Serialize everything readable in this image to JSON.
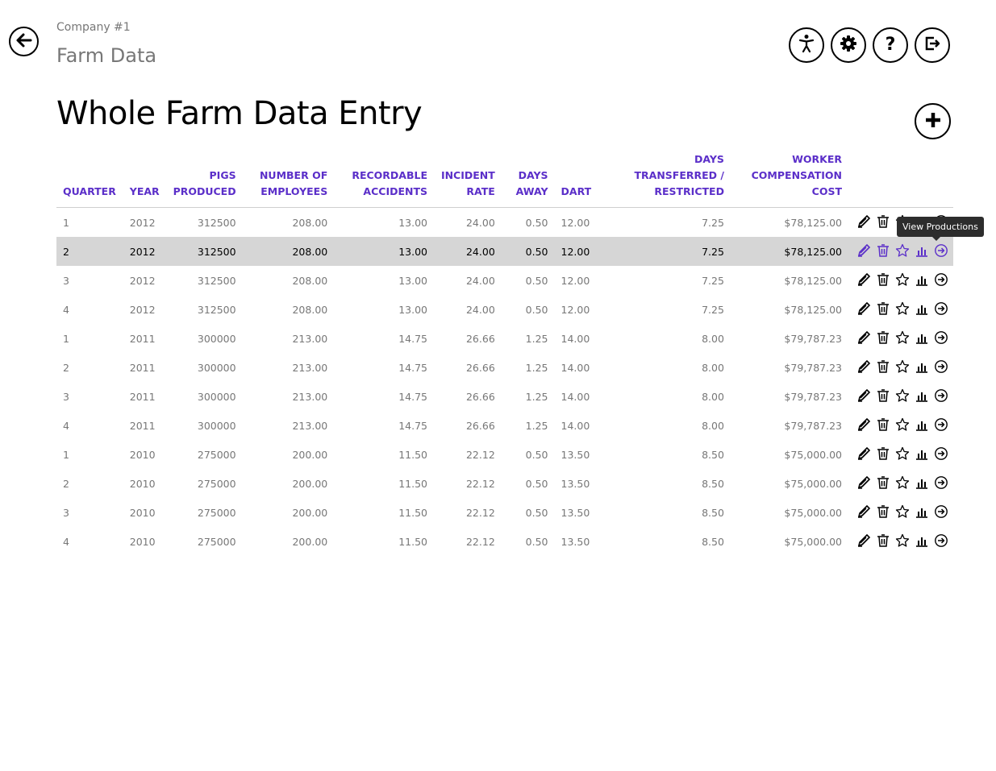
{
  "header": {
    "subtitle": "Company #1",
    "section_title": "Farm Data",
    "page_heading": "Whole Farm Data Entry",
    "back_icon": "arrow-left-icon",
    "top_buttons": [
      "accessibility-icon",
      "gear-icon",
      "help-icon",
      "logout-icon"
    ],
    "add_icon": "plus-icon"
  },
  "table": {
    "columns": [
      {
        "line1": "",
        "line2": "QUARTER"
      },
      {
        "line1": "",
        "line2": "YEAR"
      },
      {
        "line1": "PIGS",
        "line2": "PRODUCED"
      },
      {
        "line1": "NUMBER OF",
        "line2": "EMPLOYEES"
      },
      {
        "line1": "RECORDABLE",
        "line2": "ACCIDENTS"
      },
      {
        "line1": "INCIDENT",
        "line2": "RATE"
      },
      {
        "line1": "DAYS",
        "line2": "AWAY"
      },
      {
        "line1": "",
        "line2": "DART"
      },
      {
        "line1": "DAYS TRANSFERRED /",
        "line2": "RESTRICTED"
      },
      {
        "line0": "WORKER",
        "line1": "COMPENSATION",
        "line2": "COST"
      }
    ],
    "rows": [
      [
        "1",
        "2012",
        "312500",
        "208.00",
        "13.00",
        "24.00",
        "0.50",
        "12.00",
        "7.25",
        "$78,125.00"
      ],
      [
        "2",
        "2012",
        "312500",
        "208.00",
        "13.00",
        "24.00",
        "0.50",
        "12.00",
        "7.25",
        "$78,125.00"
      ],
      [
        "3",
        "2012",
        "312500",
        "208.00",
        "13.00",
        "24.00",
        "0.50",
        "12.00",
        "7.25",
        "$78,125.00"
      ],
      [
        "4",
        "2012",
        "312500",
        "208.00",
        "13.00",
        "24.00",
        "0.50",
        "12.00",
        "7.25",
        "$78,125.00"
      ],
      [
        "1",
        "2011",
        "300000",
        "213.00",
        "14.75",
        "26.66",
        "1.25",
        "14.00",
        "8.00",
        "$79,787.23"
      ],
      [
        "2",
        "2011",
        "300000",
        "213.00",
        "14.75",
        "26.66",
        "1.25",
        "14.00",
        "8.00",
        "$79,787.23"
      ],
      [
        "3",
        "2011",
        "300000",
        "213.00",
        "14.75",
        "26.66",
        "1.25",
        "14.00",
        "8.00",
        "$79,787.23"
      ],
      [
        "4",
        "2011",
        "300000",
        "213.00",
        "14.75",
        "26.66",
        "1.25",
        "14.00",
        "8.00",
        "$79,787.23"
      ],
      [
        "1",
        "2010",
        "275000",
        "200.00",
        "11.50",
        "22.12",
        "0.50",
        "13.50",
        "8.50",
        "$75,000.00"
      ],
      [
        "2",
        "2010",
        "275000",
        "200.00",
        "11.50",
        "22.12",
        "0.50",
        "13.50",
        "8.50",
        "$75,000.00"
      ],
      [
        "3",
        "2010",
        "275000",
        "200.00",
        "11.50",
        "22.12",
        "0.50",
        "13.50",
        "8.50",
        "$75,000.00"
      ],
      [
        "4",
        "2010",
        "275000",
        "200.00",
        "11.50",
        "22.12",
        "0.50",
        "13.50",
        "8.50",
        "$75,000.00"
      ]
    ],
    "highlighted_row": 1,
    "row_actions": [
      "edit-icon",
      "delete-icon",
      "favorite-icon",
      "chart-icon",
      "view-productions-icon"
    ]
  },
  "tooltip": {
    "text": "View Productions"
  },
  "colors": {
    "header_text": "#5b2fc9",
    "highlight_row": "#d6d6d6",
    "muted_text": "#777777"
  }
}
